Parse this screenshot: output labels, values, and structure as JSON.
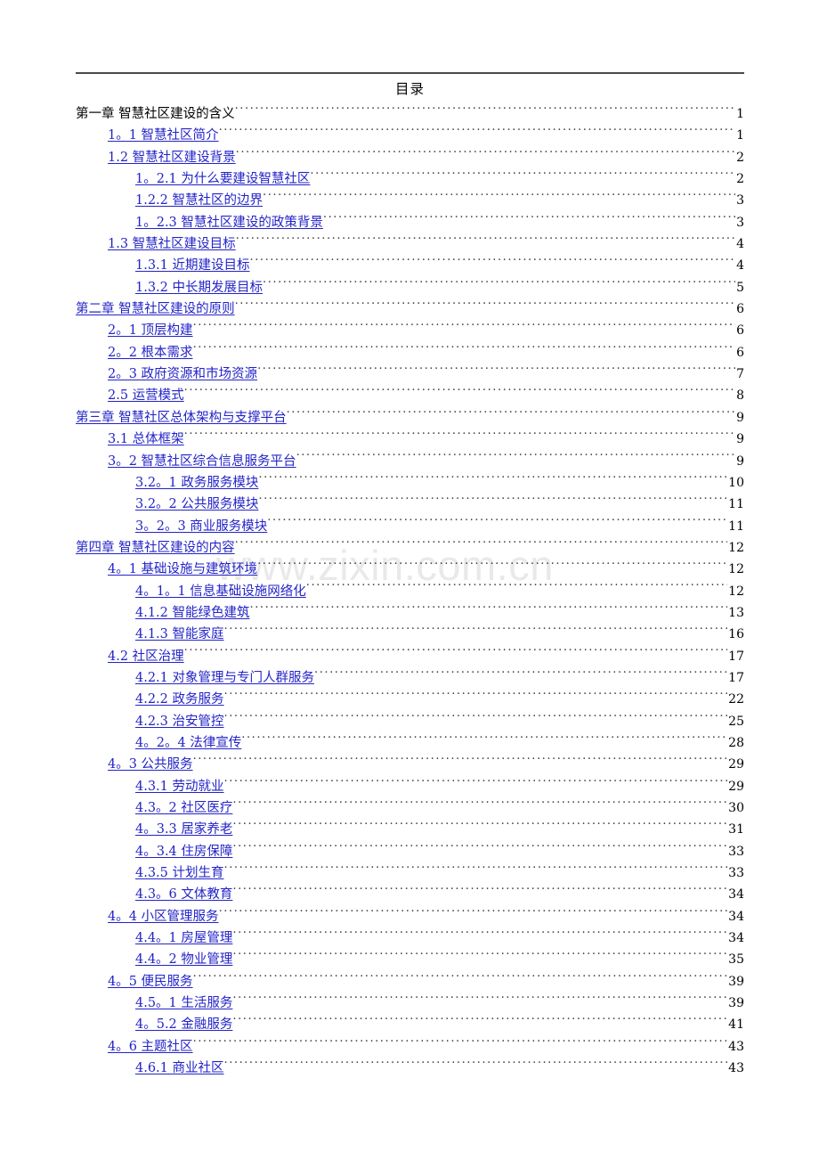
{
  "document": {
    "title": "目录",
    "watermark": "www.zixin.com.cn",
    "leader_char": "."
  },
  "toc": {
    "entries": [
      {
        "level": 1,
        "label": "第一章  智慧社区建设的含义",
        "page": "1",
        "style": "plain"
      },
      {
        "level": 2,
        "label": "1。1 智慧社区简介",
        "page": "1",
        "style": "link"
      },
      {
        "level": 2,
        "label": "1.2 智慧社区建设背景",
        "page": "2",
        "style": "link"
      },
      {
        "level": 3,
        "label": "1。2.1 为什么要建设智慧社区",
        "page": "2",
        "style": "link"
      },
      {
        "level": 3,
        "label": "1.2.2 智慧社区的边界",
        "page": "3",
        "style": "link"
      },
      {
        "level": 3,
        "label": "1。2.3 智慧社区建设的政策背景",
        "page": "3",
        "style": "link"
      },
      {
        "level": 2,
        "label": "1.3 智慧社区建设目标",
        "page": "4",
        "style": "link"
      },
      {
        "level": 3,
        "label": "1.3.1 近期建设目标",
        "page": "4",
        "style": "link"
      },
      {
        "level": 3,
        "label": "1.3.2 中长期发展目标",
        "page": "5",
        "style": "link"
      },
      {
        "level": 1,
        "label": "第二章  智慧社区建设的原则",
        "page": "6",
        "style": "link"
      },
      {
        "level": 2,
        "label": "2。1 顶层构建",
        "page": "6",
        "style": "link"
      },
      {
        "level": 2,
        "label": "2。2 根本需求",
        "page": "6",
        "style": "link"
      },
      {
        "level": 2,
        "label": "2。3 政府资源和市场资源",
        "page": "7",
        "style": "link"
      },
      {
        "level": 2,
        "label": "2.5 运营模式",
        "page": "8",
        "style": "link"
      },
      {
        "level": 1,
        "label": "第三章  智慧社区总体架构与支撑平台",
        "page": "9",
        "style": "link"
      },
      {
        "level": 2,
        "label": "3.1 总体框架",
        "page": "9",
        "style": "link"
      },
      {
        "level": 2,
        "label": "3。2 智慧社区综合信息服务平台",
        "page": "9",
        "style": "link"
      },
      {
        "level": 3,
        "label": "3.2。1 政务服务模块",
        "page": "10",
        "style": "link"
      },
      {
        "level": 3,
        "label": "3.2。2 公共服务模块",
        "page": "11",
        "style": "link"
      },
      {
        "level": 3,
        "label": "3。2。3 商业服务模块",
        "page": "11",
        "style": "link"
      },
      {
        "level": 1,
        "label": "第四章  智慧社区建设的内容",
        "page": "12",
        "style": "link"
      },
      {
        "level": 2,
        "label": "4。1 基础设施与建筑环境",
        "page": "12",
        "style": "link"
      },
      {
        "level": 3,
        "label": "4。1。1 信息基础设施网络化",
        "page": "12",
        "style": "link"
      },
      {
        "level": 3,
        "label": "4.1.2 智能绿色建筑",
        "page": "13",
        "style": "link"
      },
      {
        "level": 3,
        "label": "4.1.3 智能家庭",
        "page": "16",
        "style": "link"
      },
      {
        "level": 2,
        "label": "4.2 社区治理",
        "page": "17",
        "style": "link"
      },
      {
        "level": 3,
        "label": "4.2.1 对象管理与专门人群服务",
        "page": "17",
        "style": "link"
      },
      {
        "level": 3,
        "label": "4.2.2 政务服务",
        "page": "22",
        "style": "link"
      },
      {
        "level": 3,
        "label": "4.2.3 治安管控",
        "page": "25",
        "style": "link"
      },
      {
        "level": 3,
        "label": "4。2。4 法律宣传",
        "page": "28",
        "style": "link"
      },
      {
        "level": 2,
        "label": "4。3 公共服务",
        "page": "29",
        "style": "link"
      },
      {
        "level": 3,
        "label": "4.3.1 劳动就业",
        "page": "29",
        "style": "link"
      },
      {
        "level": 3,
        "label": "4.3。2 社区医疗",
        "page": "30",
        "style": "link"
      },
      {
        "level": 3,
        "label": "4。3.3 居家养老",
        "page": "31",
        "style": "link"
      },
      {
        "level": 3,
        "label": "4。3.4 住房保障",
        "page": "33",
        "style": "link"
      },
      {
        "level": 3,
        "label": "4.3.5 计划生育",
        "page": "33",
        "style": "link"
      },
      {
        "level": 3,
        "label": "4.3。6 文体教育",
        "page": "34",
        "style": "link"
      },
      {
        "level": 2,
        "label": "4。4 小区管理服务",
        "page": "34",
        "style": "link"
      },
      {
        "level": 3,
        "label": "4.4。1 房屋管理",
        "page": "34",
        "style": "link"
      },
      {
        "level": 3,
        "label": "4.4。2 物业管理",
        "page": "35",
        "style": "link"
      },
      {
        "level": 2,
        "label": "4。5 便民服务",
        "page": "39",
        "style": "link"
      },
      {
        "level": 3,
        "label": "4.5。1 生活服务",
        "page": "39",
        "style": "link"
      },
      {
        "level": 3,
        "label": "4。5.2 金融服务",
        "page": "41",
        "style": "link"
      },
      {
        "level": 2,
        "label": "4。6 主题社区",
        "page": "43",
        "style": "link"
      },
      {
        "level": 3,
        "label": "4.6.1 商业社区",
        "page": "43",
        "style": "link"
      }
    ]
  },
  "colors": {
    "link": "#2323c8",
    "text": "#000000",
    "rule": "#4a4a4a",
    "watermark": "#e9e9e9"
  }
}
